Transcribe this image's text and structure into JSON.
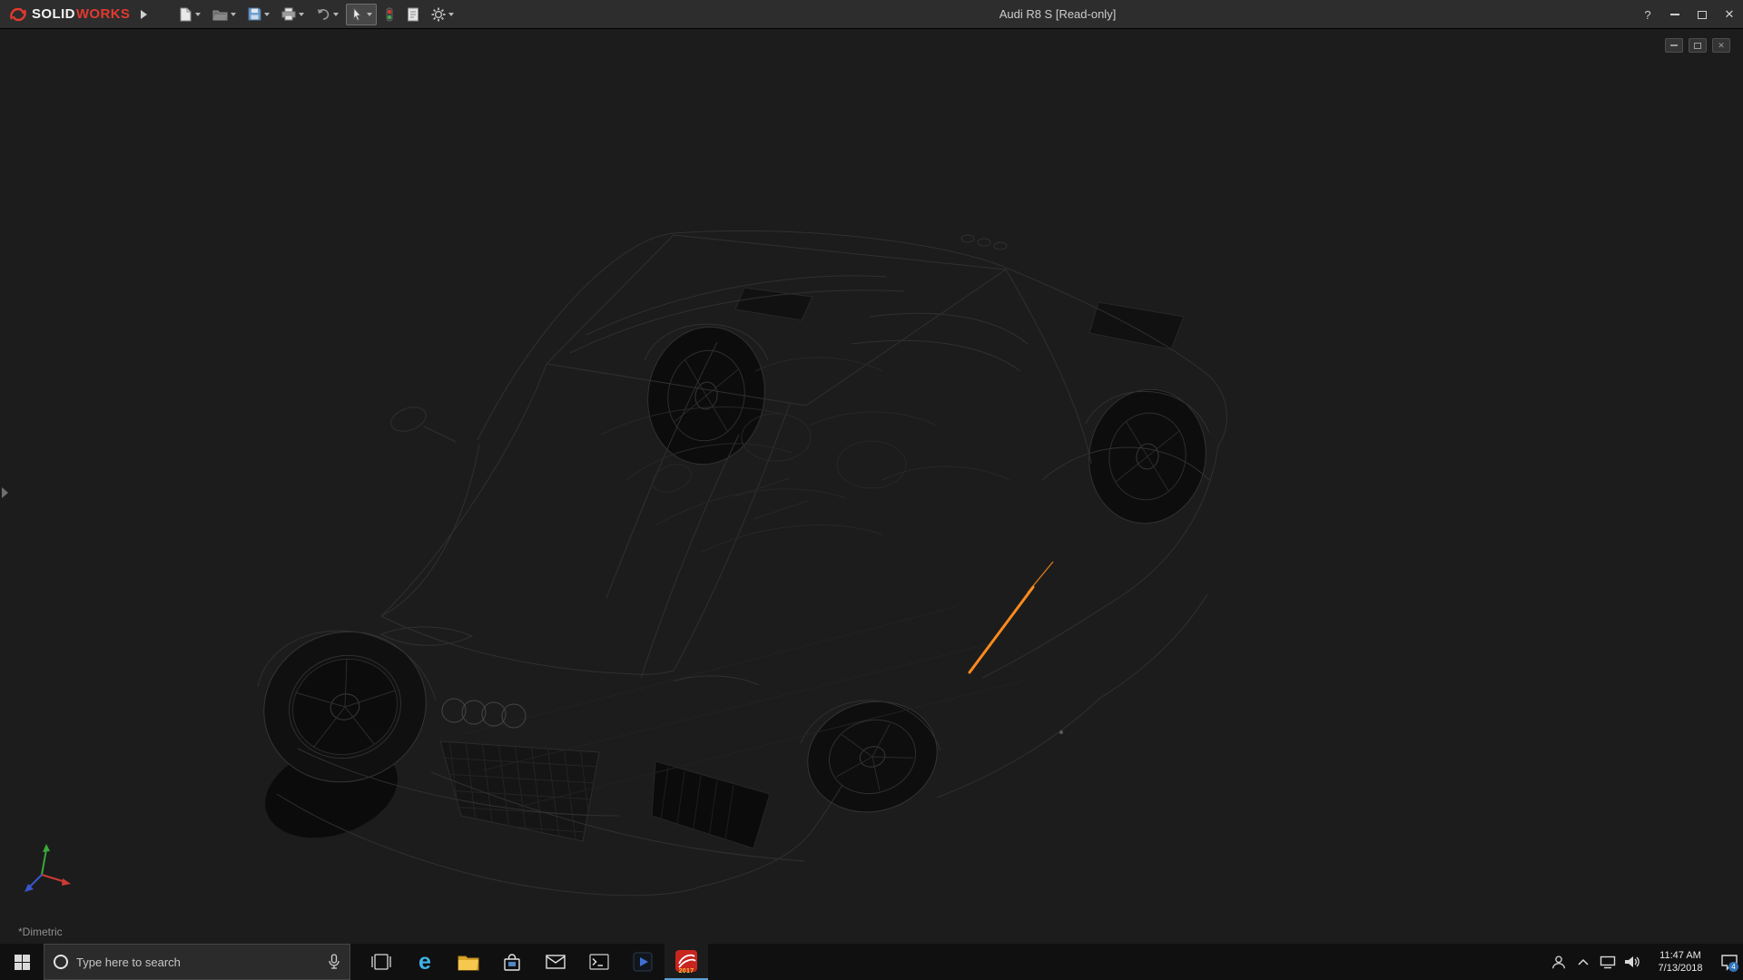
{
  "titlebar": {
    "brand": {
      "solid": "SOLID",
      "works": "WORKS"
    },
    "title": "Audi R8 S [Read-only]",
    "toolbar_icons": [
      "new-document",
      "open-document",
      "save",
      "print",
      "undo",
      "select-cursor",
      "rebuild",
      "file-properties",
      "options"
    ],
    "active_tool": "select-cursor"
  },
  "icons": {
    "help": "?",
    "close": "✕"
  },
  "viewport": {
    "view_label": "*Dimetric",
    "background": "#1c1c1c",
    "wireframe_color": "#2f2f2f",
    "selected_edge_color": "#ff8a1e",
    "document_controls": [
      "minimize",
      "restore",
      "close"
    ],
    "triad_axes": [
      "x-red",
      "y-green",
      "z-blue"
    ]
  },
  "taskbar": {
    "search": {
      "placeholder": "Type here to search"
    },
    "edge_glyph": "e",
    "sw_badge": "2017",
    "apps": [
      "task-view",
      "edge",
      "file-explorer",
      "store",
      "mail",
      "command-prompt",
      "media-app",
      "solidworks-2017"
    ],
    "tray": {
      "time": "11:47 AM",
      "date": "7/13/2018",
      "badge": "4"
    }
  }
}
